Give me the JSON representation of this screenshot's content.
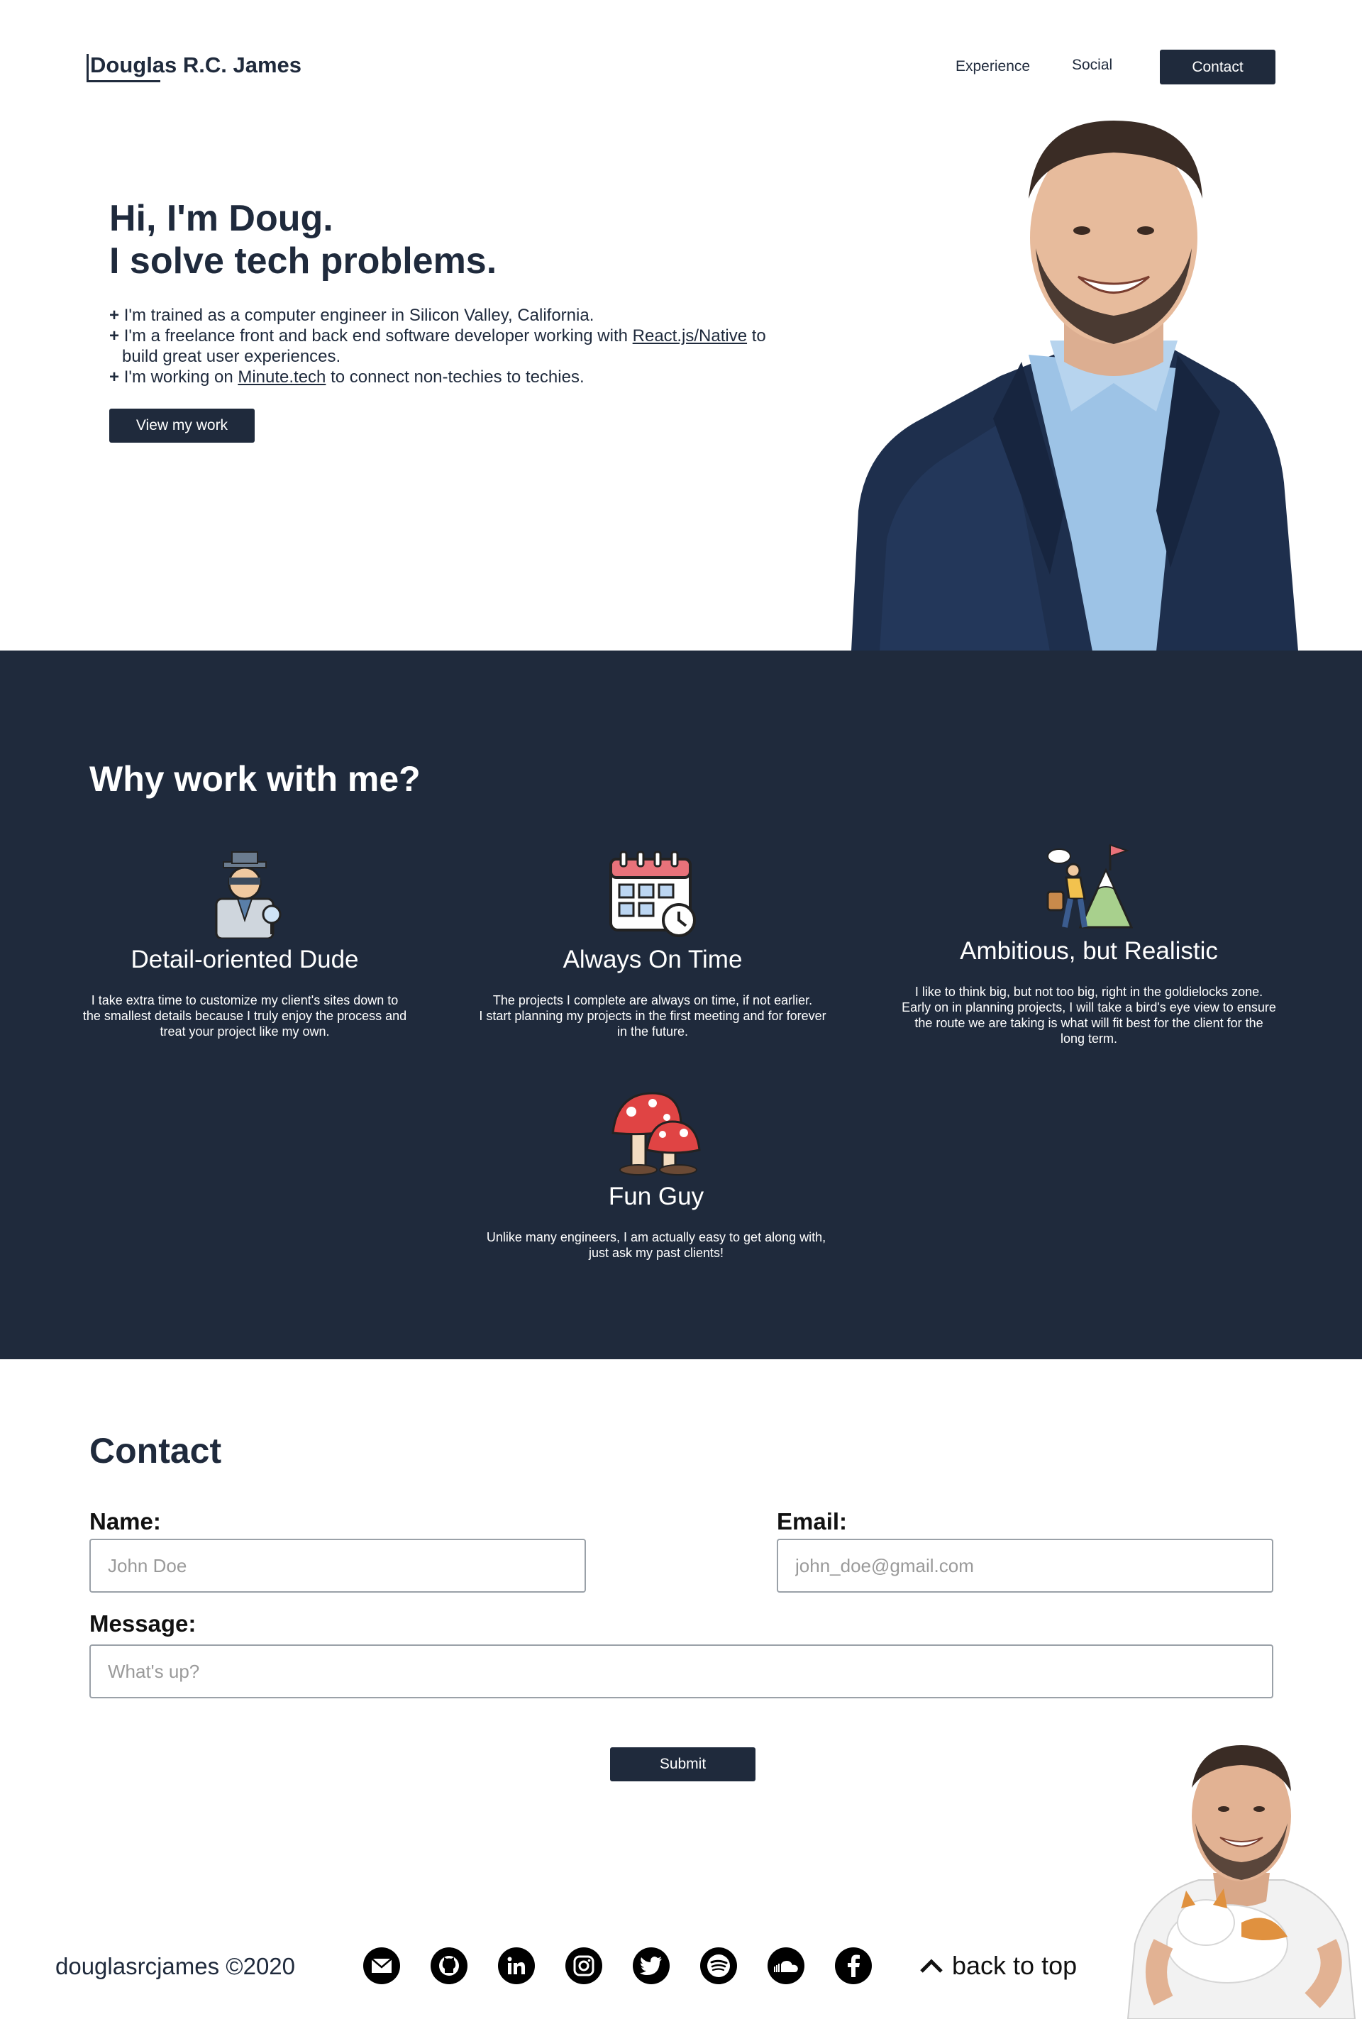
{
  "nav": {
    "brand": "Douglas R.C. James",
    "links": [
      "Experience",
      "Social"
    ],
    "contact_button": "Contact"
  },
  "hero": {
    "title_line1": "Hi, I'm Doug.",
    "title_line2": "I solve tech problems.",
    "bullet_marker": "+",
    "bullet1": "I'm trained as a computer engineer in Silicon Valley, California.",
    "bullet2_pre": "I'm a freelance front and back end software developer working with ",
    "bullet2_link": "React.js/Native",
    "bullet2_post": " to build great user experiences.",
    "bullet3_pre": "I'm working on ",
    "bullet3_link": "Minute.tech",
    "bullet3_post": " to connect non-techies to techies.",
    "cta_button": "View my work"
  },
  "why": {
    "title": "Why work with me?",
    "cards": [
      {
        "icon": "detective-icon",
        "title": "Detail-oriented Dude",
        "line1": "I take extra time to customize my client's sites down to",
        "line2": "the smallest details because I truly enjoy the process and",
        "line3": "treat your project like my own."
      },
      {
        "icon": "calendar-clock-icon",
        "title": "Always On Time",
        "line1": "The projects I complete are always on time, if not earlier.",
        "line2": "I start planning my projects in the first meeting and for forever",
        "line3": "in the future."
      },
      {
        "icon": "mountain-climber-icon",
        "title": "Ambitious, but Realistic",
        "line1": "I like to think big, but not too big, right in the goldielocks zone.",
        "line2": "Early on in planning projects, I will take a bird's eye view to ensure",
        "line3": "the route we are taking  is what will fit best for the client for the",
        "line4": "long term."
      },
      {
        "icon": "mushroom-icon",
        "title": "Fun Guy",
        "line1": "Unlike many engineers, I am actually easy to get along with,",
        "line2": "just ask my past clients!"
      }
    ]
  },
  "contact": {
    "title": "Contact",
    "name_label": "Name:",
    "name_placeholder": "John Doe",
    "email_label": "Email:",
    "email_placeholder": "john_doe@gmail.com",
    "message_label": "Message:",
    "message_placeholder": "What's up?",
    "submit": "Submit"
  },
  "footer": {
    "copyright": "douglasrcjames ©2020",
    "social_icons": [
      "email-icon",
      "github-icon",
      "linkedin-icon",
      "instagram-icon",
      "twitter-icon",
      "spotify-icon",
      "soundcloud-icon",
      "facebook-icon"
    ],
    "back_to_top": "back to top"
  },
  "colors": {
    "navy": "#1f2a3c",
    "white": "#ffffff"
  }
}
